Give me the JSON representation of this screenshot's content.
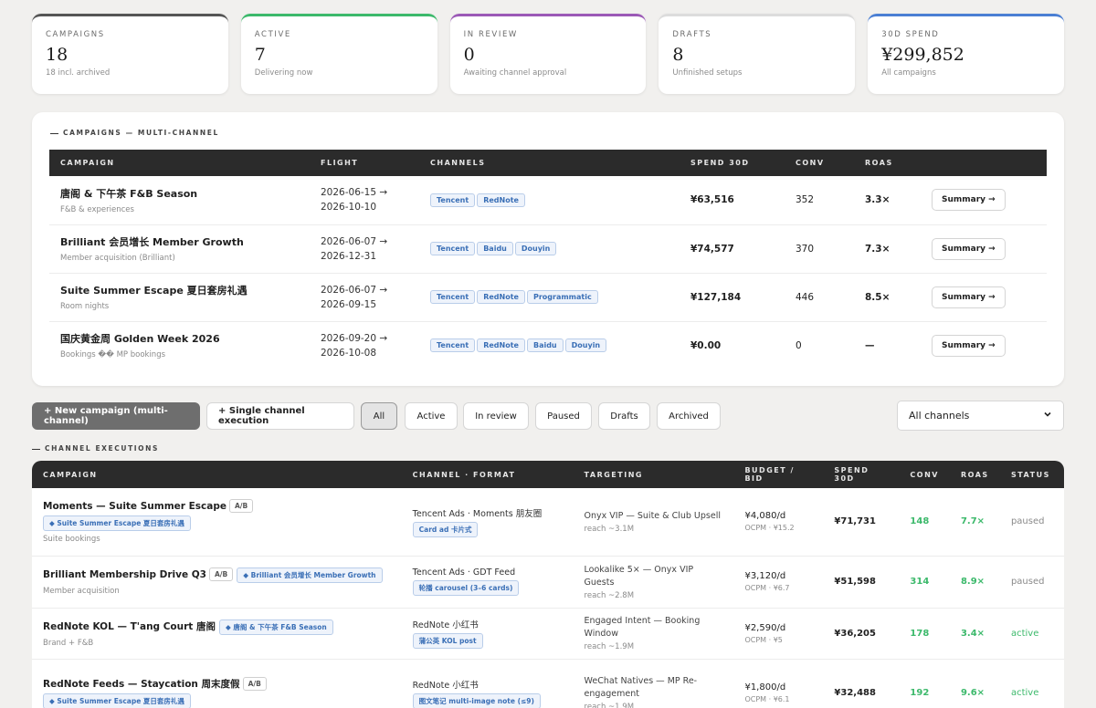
{
  "kpis": [
    {
      "label": "CAMPAIGNS",
      "value": "18",
      "sub": "18 incl. archived",
      "color": "#555555"
    },
    {
      "label": "ACTIVE",
      "value": "7",
      "sub": "Delivering now",
      "color": "#3cb96b"
    },
    {
      "label": "IN REVIEW",
      "value": "0",
      "sub": "Awaiting channel approval",
      "color": "#9b59b6"
    },
    {
      "label": "DRAFTS",
      "value": "8",
      "sub": "Unfinished setups",
      "color": "#dcdcdc"
    },
    {
      "label": "30D SPEND",
      "value": "¥299,852",
      "sub": "All campaigns",
      "color": "#4a7fd4"
    }
  ],
  "campaigns_panel": {
    "title": "CAMPAIGNS — MULTI-CHANNEL",
    "headers": [
      "CAMPAIGN",
      "FLIGHT",
      "CHANNELS",
      "SPEND 30D",
      "CONV",
      "ROAS",
      ""
    ],
    "rows": [
      {
        "name": "唐阁 & 下午茶 F&B Season",
        "sub": "F&B & experiences",
        "start": "2026-06-15 →",
        "end": "2026-10-10",
        "channels": [
          "Tencent",
          "RedNote"
        ],
        "spend": "¥63,516",
        "conv": "352",
        "roas": "3.3×",
        "action": "Summary →"
      },
      {
        "name": "Brilliant 会员增长 Member Growth",
        "sub": "Member acquisition (Brilliant)",
        "start": "2026-06-07 →",
        "end": "2026-12-31",
        "channels": [
          "Tencent",
          "Baidu",
          "Douyin"
        ],
        "spend": "¥74,577",
        "conv": "370",
        "roas": "7.3×",
        "action": "Summary →"
      },
      {
        "name": "Suite Summer Escape 夏日套房礼遇",
        "sub": "Room nights",
        "start": "2026-06-07 →",
        "end": "2026-09-15",
        "channels": [
          "Tencent",
          "RedNote",
          "Programmatic"
        ],
        "spend": "¥127,184",
        "conv": "446",
        "roas": "8.5×",
        "action": "Summary →"
      },
      {
        "name": "国庆黄金周 Golden Week 2026",
        "sub": "Bookings �� MP bookings",
        "start": "2026-09-20 →",
        "end": "2026-10-08",
        "channels": [
          "Tencent",
          "RedNote",
          "Baidu",
          "Douyin"
        ],
        "spend": "¥0.00",
        "conv": "0",
        "roas": "—",
        "action": "Summary →"
      }
    ]
  },
  "toolbar": {
    "new_campaign": "+ New campaign (multi-channel)",
    "single_channel": "+ Single channel execution",
    "filters": [
      "All",
      "Active",
      "In review",
      "Paused",
      "Drafts",
      "Archived"
    ],
    "selected_filter": "All",
    "channel_select": "All channels"
  },
  "executions": {
    "title": "CHANNEL EXECUTIONS",
    "headers": [
      "CAMPAIGN",
      "CHANNEL · FORMAT",
      "TARGETING",
      "BUDGET / BID",
      "SPEND 30D",
      "CONV",
      "ROAS",
      "STATUS"
    ],
    "rows": [
      {
        "name": "Moments — Suite Summer Escape",
        "ab": "A/B",
        "link": "◆ Suite Summer Escape 夏日套房礼遇",
        "link_inline": false,
        "sub": "Suite bookings",
        "channel": "Tencent Ads · Moments 朋友圈",
        "format": "Card ad 卡片式",
        "target": "Onyx VIP — Suite & Club Upsell",
        "reach": "reach ~3.1M",
        "budget": "¥4,080/d",
        "bid": "OCPM · ¥15.2",
        "spend": "¥71,731",
        "conv": "148",
        "roas": "7.7×",
        "status": "paused"
      },
      {
        "name": "Brilliant Membership Drive Q3",
        "ab": "A/B",
        "link": "◆ Brilliant 会员增长 Member Growth",
        "link_inline": true,
        "sub": "Member acquisition",
        "channel": "Tencent Ads · GDT Feed",
        "format": "轮播 carousel (3–6 cards)",
        "target": "Lookalike 5× — Onyx VIP Guests",
        "reach": "reach ~2.8M",
        "budget": "¥3,120/d",
        "bid": "OCPM · ¥6.7",
        "spend": "¥51,598",
        "conv": "314",
        "roas": "8.9×",
        "status": "paused"
      },
      {
        "name": "RedNote KOL — T'ang Court 唐阁",
        "ab": "",
        "link": "◆ 唐阁 & 下午茶 F&B Season",
        "link_inline": true,
        "sub": "Brand + F&B",
        "channel": "RedNote 小红书",
        "format": "蒲公英 KOL post",
        "target": "Engaged Intent — Booking Window",
        "reach": "reach ~1.9M",
        "budget": "¥2,590/d",
        "bid": "OCPM · ¥5",
        "spend": "¥36,205",
        "conv": "178",
        "roas": "3.4×",
        "status": "active"
      },
      {
        "name": "RedNote Feeds — Staycation 周末度假",
        "ab": "A/B",
        "link": "◆ Suite Summer Escape 夏日套房礼遇",
        "link_inline": false,
        "sub": "",
        "channel": "RedNote 小红书",
        "format": "图文笔记 multi-image note (≤9)",
        "target": "WeChat Natives — MP Re-engagement",
        "reach": "reach ~1.9M",
        "budget": "¥1,800/d",
        "bid": "OCPM · ¥6.1",
        "spend": "¥32,488",
        "conv": "192",
        "roas": "9.6×",
        "status": "active"
      }
    ]
  }
}
